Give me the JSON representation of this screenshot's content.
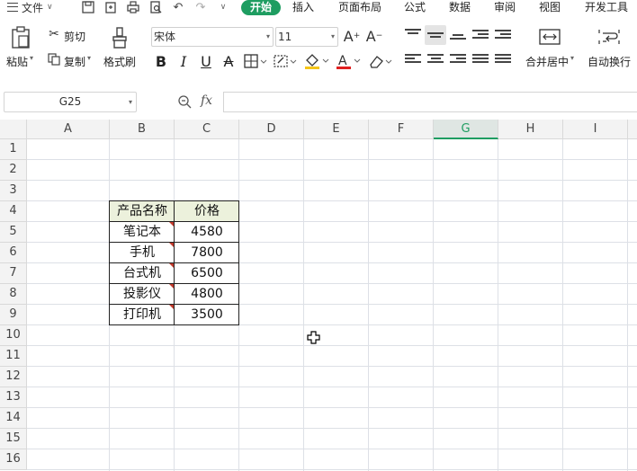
{
  "menu": {
    "file_label": "文件",
    "tabs": [
      "开始",
      "插入",
      "页面布局",
      "公式",
      "数据",
      "审阅",
      "视图",
      "开发工具"
    ],
    "active_tab": "开始"
  },
  "ribbon": {
    "paste": "粘贴",
    "cut": "剪切",
    "copy": "复制",
    "format_painter": "格式刷",
    "font_name": "宋体",
    "font_size": "11",
    "merge_center": "合并居中",
    "wrap_text": "自动换行"
  },
  "formula_bar": {
    "name_box": "G25",
    "fx": "fx",
    "value": ""
  },
  "sheet": {
    "columns": [
      "A",
      "B",
      "C",
      "D",
      "E",
      "F",
      "G",
      "H",
      "I"
    ],
    "selected_column": "G",
    "rows": [
      "1",
      "2",
      "3",
      "4",
      "5",
      "6",
      "7",
      "8",
      "9",
      "10",
      "11",
      "12",
      "13",
      "14",
      "15",
      "16"
    ],
    "table": {
      "headers": [
        "产品名称",
        "价格"
      ],
      "rows": [
        [
          "笔记本",
          "4580"
        ],
        [
          "手机",
          "7800"
        ],
        [
          "台式机",
          "6500"
        ],
        [
          "投影仪",
          "4800"
        ],
        [
          "打印机",
          "3500"
        ]
      ]
    }
  },
  "colors": {
    "accent": "#1e9d61",
    "header_fill": "#ecf1dc",
    "comment_marker": "#c0392b"
  }
}
